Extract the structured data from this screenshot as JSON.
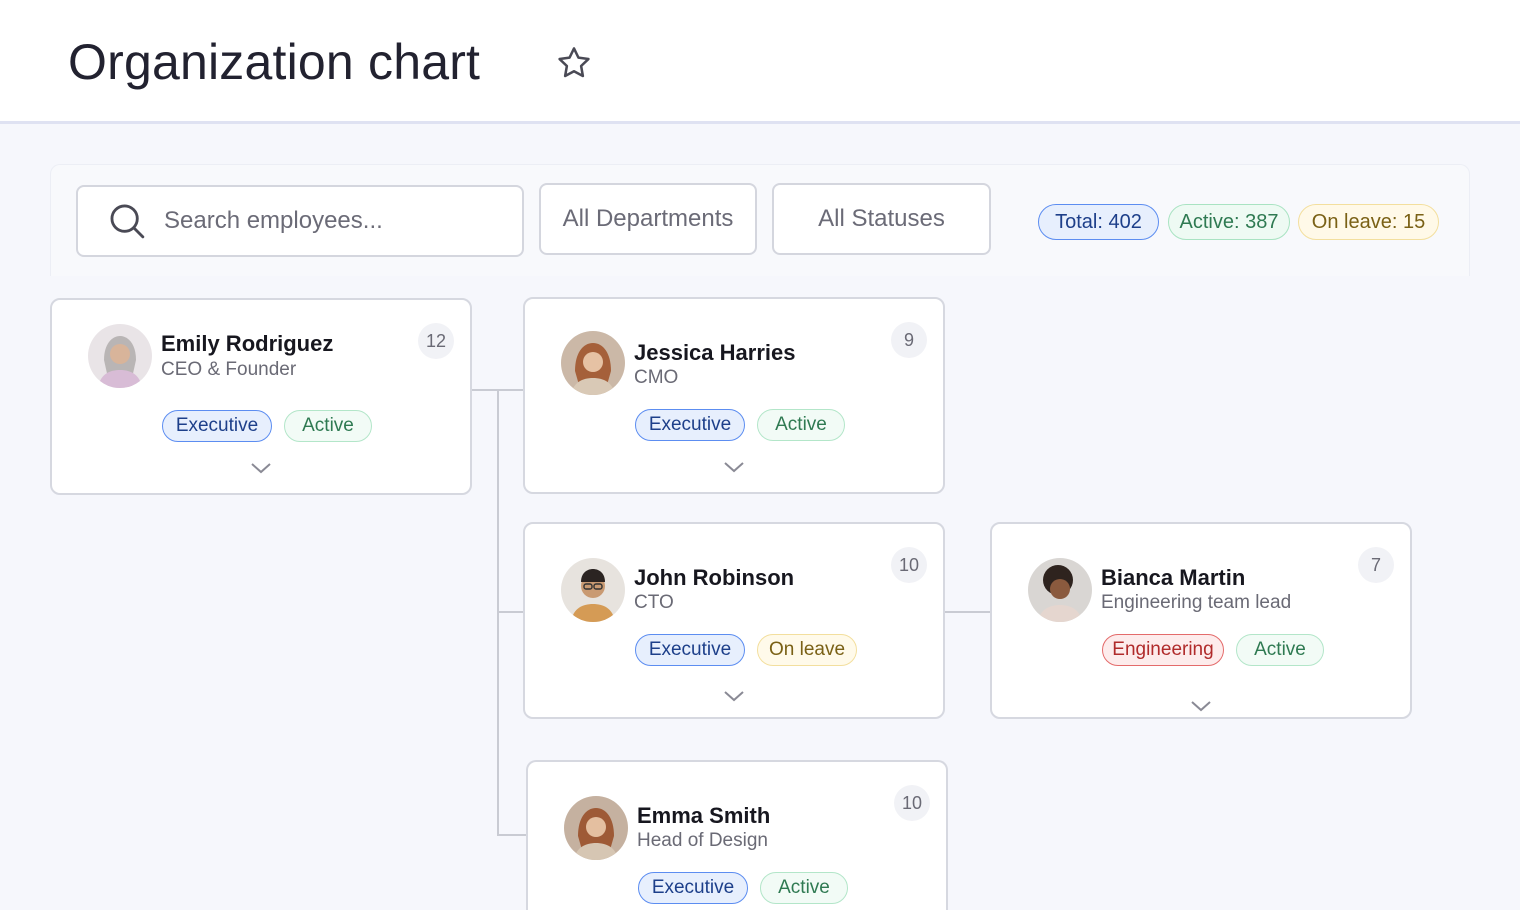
{
  "header": {
    "title": "Organization chart",
    "favorite_icon": "star-icon"
  },
  "toolbar": {
    "search_placeholder": "Search employees...",
    "department_filter": "All Departments",
    "status_filter": "All Statuses",
    "stats": {
      "total": "Total:  402",
      "active": "Active: 387",
      "on_leave": "On leave:  15"
    }
  },
  "colors": {
    "executive": "#5c8df1",
    "active": "#b3e6c9",
    "on_leave": "#f3df9e",
    "engineering": "#e46b6b"
  },
  "employees": [
    {
      "name": "Emily Rodriguez",
      "role": "CEO & Founder",
      "count": "12",
      "department": "Executive",
      "status": "Active"
    },
    {
      "name": "Jessica Harries",
      "role": "CMO",
      "count": "9",
      "department": "Executive",
      "status": "Active"
    },
    {
      "name": "John Robinson",
      "role": "CTO",
      "count": "10",
      "department": "Executive",
      "status": "On leave"
    },
    {
      "name": "Bianca Martin",
      "role": "Engineering team lead",
      "count": "7",
      "department": "Engineering",
      "status": "Active"
    },
    {
      "name": "Emma Smith",
      "role": "Head of Design",
      "count": "10",
      "department": "Executive",
      "status": "Active"
    }
  ]
}
